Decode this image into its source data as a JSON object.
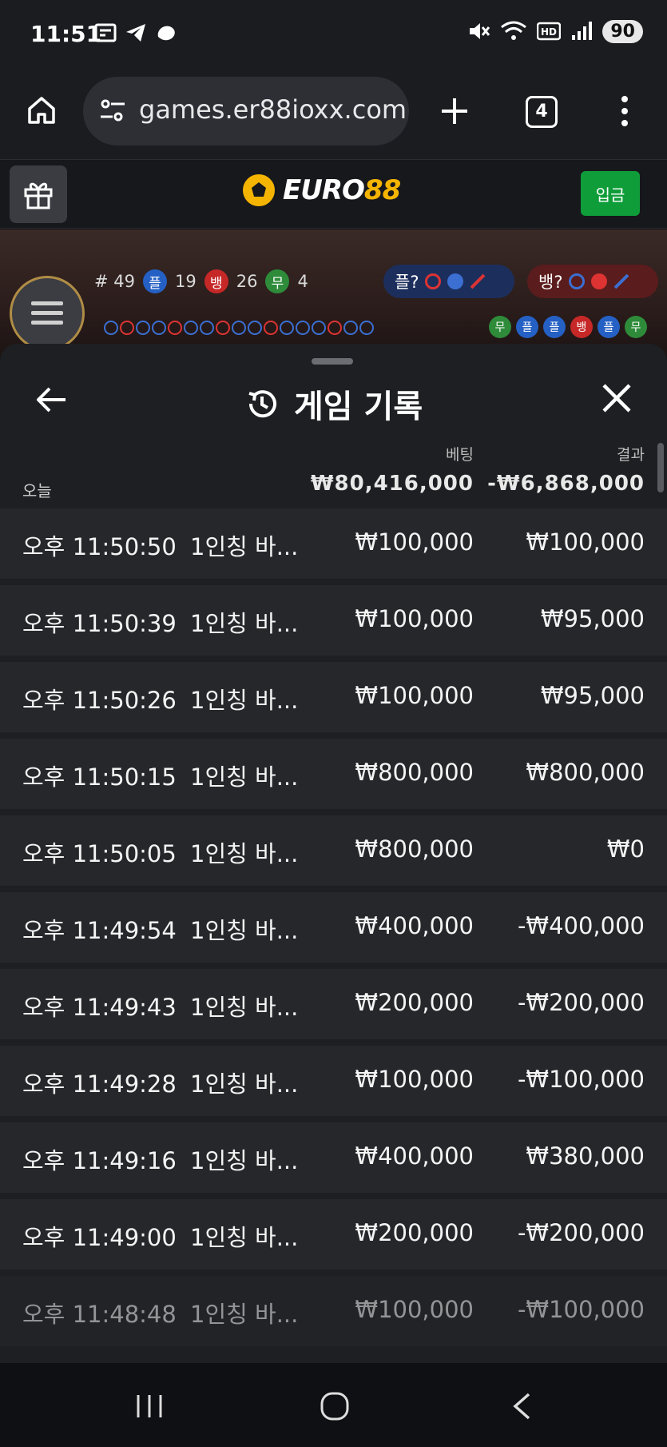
{
  "status_bar": {
    "time": "11:51",
    "battery": "90"
  },
  "browser": {
    "url": "games.er88ioxx.com",
    "tab_count": "4"
  },
  "site": {
    "logo_main": "EURO",
    "logo_accent": "88",
    "deposit_label": "입금"
  },
  "game": {
    "round": "# 49",
    "player_label": "플",
    "player_count": "19",
    "banker_label": "뱅",
    "banker_count": "26",
    "tie_label": "무",
    "tie_count": "4",
    "player_predict": "플?",
    "banker_predict": "뱅?",
    "recent_chips": [
      {
        "label": "무",
        "color": "#2e8b3a"
      },
      {
        "label": "플",
        "color": "#2560c4"
      },
      {
        "label": "플",
        "color": "#2560c4"
      },
      {
        "label": "뱅",
        "color": "#c62828"
      },
      {
        "label": "플",
        "color": "#2560c4"
      },
      {
        "label": "무",
        "color": "#2e8b3a"
      }
    ]
  },
  "history": {
    "title": "게임 기록",
    "bet_header": "베팅",
    "result_header": "결과",
    "today_label": "오늘",
    "total_bet": "₩80,416,000",
    "total_result": "-₩6,868,000",
    "rows": [
      {
        "time": "오후 11:50:50",
        "game": "1인칭 바...",
        "bet": "₩100,000",
        "result": "₩100,000"
      },
      {
        "time": "오후 11:50:39",
        "game": "1인칭 바...",
        "bet": "₩100,000",
        "result": "₩95,000"
      },
      {
        "time": "오후 11:50:26",
        "game": "1인칭 바...",
        "bet": "₩100,000",
        "result": "₩95,000"
      },
      {
        "time": "오후 11:50:15",
        "game": "1인칭 바...",
        "bet": "₩800,000",
        "result": "₩800,000"
      },
      {
        "time": "오후 11:50:05",
        "game": "1인칭 바...",
        "bet": "₩800,000",
        "result": "₩0"
      },
      {
        "time": "오후 11:49:54",
        "game": "1인칭 바...",
        "bet": "₩400,000",
        "result": "-₩400,000"
      },
      {
        "time": "오후 11:49:43",
        "game": "1인칭 바...",
        "bet": "₩200,000",
        "result": "-₩200,000"
      },
      {
        "time": "오후 11:49:28",
        "game": "1인칭 바...",
        "bet": "₩100,000",
        "result": "-₩100,000"
      },
      {
        "time": "오후 11:49:16",
        "game": "1인칭 바...",
        "bet": "₩400,000",
        "result": "₩380,000"
      },
      {
        "time": "오후 11:49:00",
        "game": "1인칭 바...",
        "bet": "₩200,000",
        "result": "-₩200,000"
      },
      {
        "time": "오후 11:48:48",
        "game": "1인칭 바...",
        "bet": "₩100,000",
        "result": "-₩100,000"
      }
    ]
  }
}
